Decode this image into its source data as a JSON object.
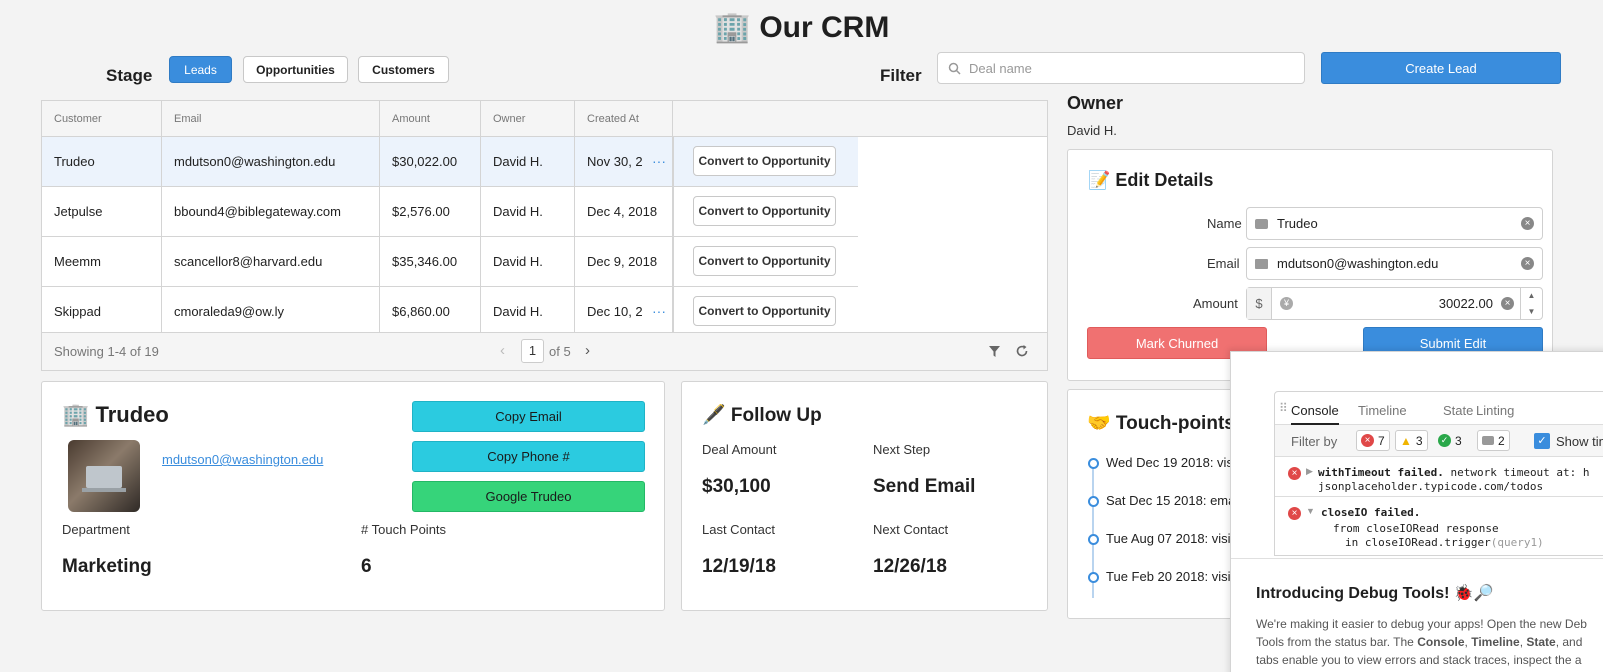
{
  "app": {
    "title": "🏢 Our CRM"
  },
  "stage": {
    "label": "Stage",
    "buttons": [
      {
        "label": "Leads",
        "active": true
      },
      {
        "label": "Opportunities",
        "active": false
      },
      {
        "label": "Customers",
        "active": false
      }
    ]
  },
  "filter": {
    "label": "Filter",
    "placeholder": "Deal name"
  },
  "create_lead": {
    "label": "Create Lead"
  },
  "table": {
    "columns": [
      "Customer",
      "Email",
      "Amount",
      "Owner",
      "Created At"
    ],
    "rows": [
      {
        "customer": "Trudeo",
        "email": "mdutson0@washington.edu",
        "amount": "$30,022.00",
        "owner": "David H.",
        "created": "Nov 30, 2",
        "action": "Convert to Opportunity"
      },
      {
        "customer": "Jetpulse",
        "email": "bbound4@biblegateway.com",
        "amount": "$2,576.00",
        "owner": "David H.",
        "created": "Dec 4, 2018",
        "action": "Convert to Opportunity"
      },
      {
        "customer": "Meemm",
        "email": "scancellor8@harvard.edu",
        "amount": "$35,346.00",
        "owner": "David H.",
        "created": "Dec 9, 2018",
        "action": "Convert to Opportunity"
      },
      {
        "customer": "Skippad",
        "email": "cmoraleda9@ow.ly",
        "amount": "$6,860.00",
        "owner": "David H.",
        "created": "Dec 10, 2",
        "action": "Convert to Opportunity"
      }
    ],
    "footer": {
      "showing": "Showing 1-4 of 19",
      "page": "1",
      "of_pages": "of 5"
    }
  },
  "owner": {
    "heading": "Owner",
    "value": "David H."
  },
  "edit_details": {
    "heading": "📝 Edit Details",
    "name_label": "Name",
    "name_value": "Trudeo",
    "email_label": "Email",
    "email_value": "mdutson0@washington.edu",
    "amount_label": "Amount",
    "currency": "$",
    "amount_value": "30022.00",
    "mark_churned": "Mark Churned",
    "submit_edit": "Submit Edit"
  },
  "profile": {
    "heading": "🏢 Trudeo",
    "email_link": "mdutson0@washington.edu",
    "copy_email": "Copy Email",
    "copy_phone": "Copy Phone #",
    "google": "Google Trudeo",
    "department_label": "Department",
    "department_value": "Marketing",
    "touch_points_label": "# Touch Points",
    "touch_points_value": "6"
  },
  "follow_up": {
    "heading": "🖋️ Follow Up",
    "deal_amount_label": "Deal Amount",
    "deal_amount_value": "$30,100",
    "next_step_label": "Next Step",
    "next_step_value": "Send Email",
    "last_contact_label": "Last Contact",
    "last_contact_value": "12/19/18",
    "next_contact_label": "Next Contact",
    "next_contact_value": "12/26/18"
  },
  "touch_points": {
    "heading": "🤝 Touch-points",
    "items": [
      "Wed Dec 19 2018: visi",
      "Sat Dec 15 2018: ema",
      "Tue Aug 07 2018: visi",
      "Tue Feb 20 2018: visi"
    ]
  },
  "debug": {
    "tabs": [
      "Console",
      "Timeline",
      "State",
      "Linting"
    ],
    "filter_by": "Filter by",
    "counts": {
      "errors": "7",
      "warnings": "3",
      "success": "3",
      "info": "2"
    },
    "show_timing": "Show tim",
    "log1_title": "withTimeout failed.",
    "log1_text": "network timeout at: h",
    "log1_text2": "jsonplaceholder.typicode.com/todos",
    "log2_title": "closeIO failed.",
    "log2_line1": "from closeIORead response",
    "log2_line2": "in closeIORead.trigger",
    "log2_arg": "(query1)",
    "intro_title": "Introducing Debug Tools! 🐞🔎",
    "intro_p1a": "We're making it easier to debug your apps! Open the new Deb",
    "intro_p1b": "Tools from the status bar. The ",
    "console_w": "Console",
    "timeline_w": "Timeline",
    "state_w": "State",
    "and_w": ", and",
    "intro_p3": "tabs enable you to view errors and stack traces, inspect the a"
  },
  "colors": {
    "primary": "#3a8ddd",
    "cyan": "#2bcbe0",
    "green": "#36d47a",
    "danger": "#f07171"
  }
}
